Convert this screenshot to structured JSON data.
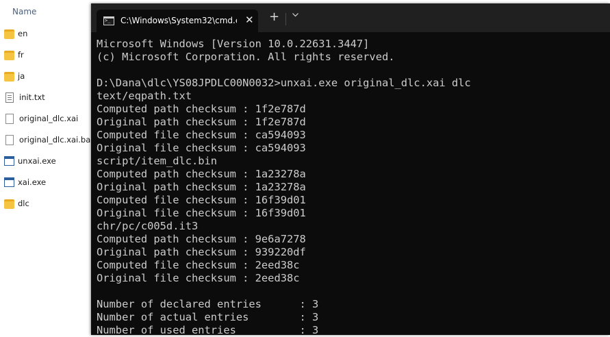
{
  "explorer": {
    "column_header": "Name",
    "items": [
      {
        "name": "en",
        "type": "folder",
        "icon": "folder-icon"
      },
      {
        "name": "fr",
        "type": "folder",
        "icon": "folder-icon"
      },
      {
        "name": "ja",
        "type": "folder",
        "icon": "folder-icon"
      },
      {
        "name": "init.txt",
        "type": "text",
        "icon": "text-file-icon"
      },
      {
        "name": "original_dlc.xai",
        "type": "file",
        "icon": "file-icon"
      },
      {
        "name": "original_dlc.xai.bak",
        "type": "file",
        "icon": "file-icon"
      },
      {
        "name": "unxai.exe",
        "type": "exe",
        "icon": "exe-icon"
      },
      {
        "name": "xai.exe",
        "type": "exe",
        "icon": "exe-icon"
      },
      {
        "name": "dlc",
        "type": "folder",
        "icon": "folder-icon"
      }
    ]
  },
  "terminal": {
    "tab_title": "C:\\Windows\\System32\\cmd.e",
    "close_glyph": "✕",
    "new_tab_glyph": "+",
    "lines": [
      "Microsoft Windows [Version 10.0.22631.3447]",
      "(c) Microsoft Corporation. All rights reserved.",
      "",
      "D:\\Dana\\dlc\\YS08JPDLC00N0032>unxai.exe original_dlc.xai dlc",
      "text/eqpath.txt",
      "Computed path checksum : 1f2e787d",
      "Original path checksum : 1f2e787d",
      "Computed file checksum : ca594093",
      "Original file checksum : ca594093",
      "script/item_dlc.bin",
      "Computed path checksum : 1a23278a",
      "Original path checksum : 1a23278a",
      "Computed file checksum : 16f39d01",
      "Original file checksum : 16f39d01",
      "chr/pc/c005d.it3",
      "Computed path checksum : 9e6a7278",
      "Original path checksum : 939220df",
      "Computed file checksum : 2eed38c",
      "Original file checksum : 2eed38c",
      "",
      "Number of declared entries      : 3",
      "Number of actual entries        : 3",
      "Number of used entries          : 3"
    ]
  }
}
